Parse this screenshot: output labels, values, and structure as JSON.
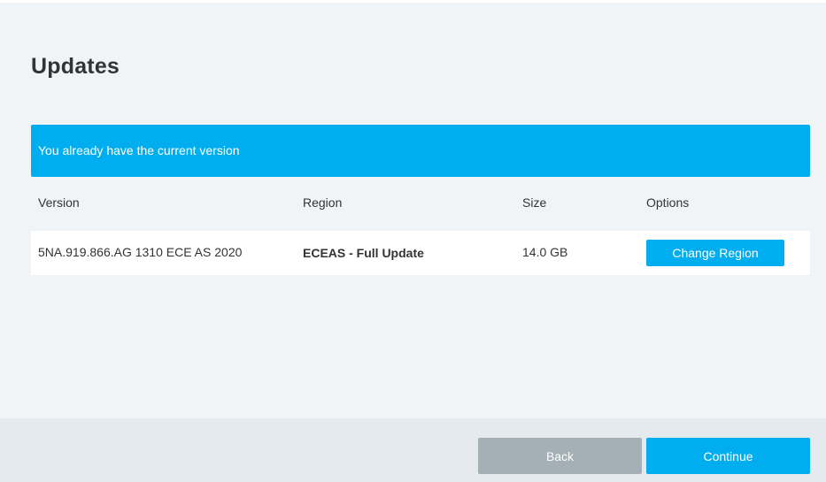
{
  "page": {
    "title": "Updates"
  },
  "banner": {
    "message": "You already have the current version"
  },
  "table": {
    "columns": [
      "Version",
      "Region",
      "Size",
      "Options"
    ],
    "rows": [
      {
        "version": "5NA.919.866.AG 1310 ECE AS 2020",
        "region": "ECEAS - Full Update",
        "size": "14.0 GB",
        "option_button": "Change Region"
      }
    ]
  },
  "footer": {
    "back_label": "Back",
    "continue_label": "Continue"
  },
  "colors": {
    "accent": "#00aeef",
    "background": "#f0f4f7",
    "footer_background": "#e4eaed",
    "disabled_button": "#a4b0b5"
  }
}
